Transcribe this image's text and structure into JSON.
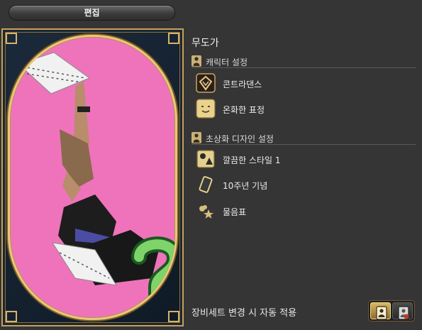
{
  "header": {
    "edit_label": "편집"
  },
  "portrait": {
    "background_color": "#ef73bb",
    "frame_color": "#c6a15a"
  },
  "main": {
    "title": "무도가",
    "sections": [
      {
        "label": "캐릭터 설정",
        "icon": "character-silhouette-icon",
        "items": [
          {
            "label": "콘트라댄스",
            "icon": "dance-pose-icon"
          },
          {
            "label": "온화한 표정",
            "icon": "smiling-face-icon"
          }
        ]
      },
      {
        "label": "초상화 디자인 설정",
        "icon": "portrait-silhouette-icon",
        "items": [
          {
            "label": "깔끔한 스타일 1",
            "icon": "backdrop-style-icon"
          },
          {
            "label": "10주년 기념",
            "icon": "frame-card-icon"
          },
          {
            "label": "물음표",
            "icon": "question-mark-accent-icon"
          }
        ]
      }
    ]
  },
  "footer": {
    "auto_apply_label": "장비세트 변경 시 자동 적용",
    "toggle_on_icon": "auto-apply-on-icon",
    "toggle_off_icon": "auto-apply-off-icon"
  },
  "colors": {
    "accent_gold": "#c6a15a",
    "background": "#353535"
  }
}
